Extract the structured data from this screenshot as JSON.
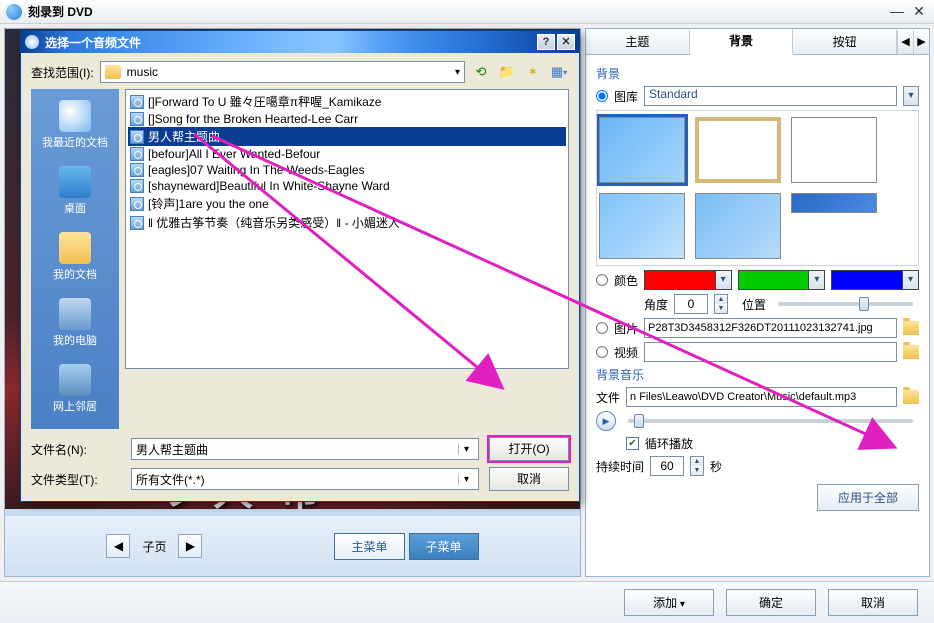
{
  "window": {
    "title": "刻录到 DVD"
  },
  "tabs": {
    "theme": "主题",
    "background": "背景",
    "button": "按钮"
  },
  "panel": {
    "bg_title": "背景",
    "lib_label": "图库",
    "lib_value": "Standard",
    "color_label": "颜色",
    "angle_label": "角度",
    "angle_value": "0",
    "position_label": "位置",
    "image_label": "图片",
    "image_value": "P28T3D3458312F326DT20111023132741.jpg",
    "video_label": "视频",
    "music_title": "背景音乐",
    "file_label": "文件",
    "file_value": "n Files\\Leawo\\DVD Creator\\Music\\default.mp3",
    "loop_label": "循环播放",
    "duration_label": "持续时间",
    "duration_value": "60",
    "duration_unit": "秒",
    "apply_all": "应用于全部"
  },
  "nav": {
    "sub_label": "子页",
    "main_menu": "主菜单",
    "sub_menu": "子菜单"
  },
  "footer": {
    "add": "添加",
    "ok": "确定",
    "cancel": "取消"
  },
  "dialog": {
    "title": "选择一个音频文件",
    "lookin_label": "查找范围(I):",
    "lookin_value": "music",
    "places": {
      "recent": "我最近的文档",
      "desktop": "桌面",
      "docs": "我的文档",
      "computer": "我的电脑",
      "network": "网上邻居"
    },
    "files": [
      "[]Forward To U 雖々圧噶章π秤喔_Kamikaze",
      "[]Song for the Broken Hearted-Lee Carr",
      "男人帮主题曲",
      "[befour]All I Ever Wanted-Befour",
      "[eagles]07 Waiting In The Weeds-Eagles",
      "[shayneward]Beautiful In White-Shayne Ward",
      "[铃声]1are you the one",
      "‖ 优雅古筝节奏（纯音乐另类感受）‖ - 小媚迷人"
    ],
    "selected_index": 2,
    "filename_label": "文件名(N):",
    "filename_value": "男人帮主题曲",
    "filetype_label": "文件类型(T):",
    "filetype_value": "所有文件(*.*)",
    "open": "打开(O)",
    "cancel": "取消"
  },
  "chart_data": null
}
